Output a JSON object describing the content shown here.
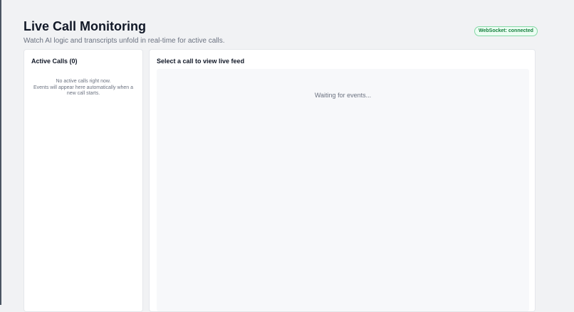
{
  "header": {
    "title": "Live Call Monitoring",
    "subtitle": "Watch AI logic and transcripts unfold in real-time for active calls."
  },
  "status": {
    "websocket_label": "WebSocket: connected",
    "color": "#15803d"
  },
  "calls_panel": {
    "title": "Active Calls (0)",
    "empty_line1": "No active calls right now.",
    "empty_line2": "Events will appear here automatically when a new call starts."
  },
  "feed_panel": {
    "title": "Select a call to view live feed",
    "waiting_text": "Waiting for events..."
  }
}
